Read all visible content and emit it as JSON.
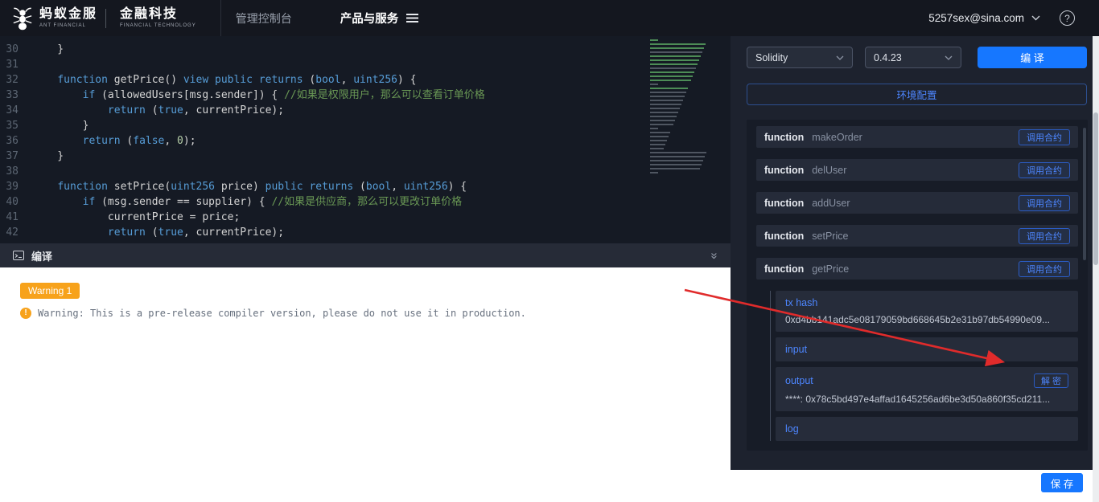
{
  "header": {
    "brand": {
      "name_cn": "蚂蚁金服",
      "name_en": "ANT FINANCIAL",
      "division_cn": "金融科技",
      "division_en": "FINANCIAL TECHNOLOGY"
    },
    "nav_console": "管理控制台",
    "nav_products": "产品与服务",
    "account": "5257sex@sina.com",
    "help_label": "?"
  },
  "editor": {
    "lines": [
      {
        "no": "30",
        "tokens": [
          {
            "t": "    }",
            "c": "p"
          }
        ]
      },
      {
        "no": "31",
        "tokens": [
          {
            "t": "",
            "c": "p"
          }
        ]
      },
      {
        "no": "32",
        "tokens": [
          {
            "t": "    ",
            "c": "p"
          },
          {
            "t": "function",
            "c": "k"
          },
          {
            "t": " getPrice() ",
            "c": "p"
          },
          {
            "t": "view",
            "c": "k"
          },
          {
            "t": " ",
            "c": "p"
          },
          {
            "t": "public",
            "c": "k"
          },
          {
            "t": " ",
            "c": "p"
          },
          {
            "t": "returns",
            "c": "k"
          },
          {
            "t": " (",
            "c": "p"
          },
          {
            "t": "bool",
            "c": "k"
          },
          {
            "t": ", ",
            "c": "p"
          },
          {
            "t": "uint256",
            "c": "k"
          },
          {
            "t": ") {",
            "c": "p"
          }
        ]
      },
      {
        "no": "33",
        "tokens": [
          {
            "t": "        ",
            "c": "p"
          },
          {
            "t": "if",
            "c": "k"
          },
          {
            "t": " (allowedUsers[msg.sender]) { ",
            "c": "p"
          },
          {
            "t": "//如果是权限用户，那么可以查看订单价格",
            "c": "c"
          }
        ]
      },
      {
        "no": "34",
        "tokens": [
          {
            "t": "            ",
            "c": "p"
          },
          {
            "t": "return",
            "c": "k"
          },
          {
            "t": " (",
            "c": "p"
          },
          {
            "t": "true",
            "c": "k"
          },
          {
            "t": ", currentPrice);",
            "c": "p"
          }
        ]
      },
      {
        "no": "35",
        "tokens": [
          {
            "t": "        }",
            "c": "p"
          }
        ]
      },
      {
        "no": "36",
        "tokens": [
          {
            "t": "        ",
            "c": "p"
          },
          {
            "t": "return",
            "c": "k"
          },
          {
            "t": " (",
            "c": "p"
          },
          {
            "t": "false",
            "c": "k"
          },
          {
            "t": ", ",
            "c": "p"
          },
          {
            "t": "0",
            "c": "n"
          },
          {
            "t": ");",
            "c": "p"
          }
        ]
      },
      {
        "no": "37",
        "tokens": [
          {
            "t": "    }",
            "c": "p"
          }
        ]
      },
      {
        "no": "38",
        "tokens": [
          {
            "t": "",
            "c": "p"
          }
        ]
      },
      {
        "no": "39",
        "tokens": [
          {
            "t": "    ",
            "c": "p"
          },
          {
            "t": "function",
            "c": "k"
          },
          {
            "t": " setPrice(",
            "c": "p"
          },
          {
            "t": "uint256",
            "c": "k"
          },
          {
            "t": " price) ",
            "c": "p"
          },
          {
            "t": "public",
            "c": "k"
          },
          {
            "t": " ",
            "c": "p"
          },
          {
            "t": "returns",
            "c": "k"
          },
          {
            "t": " (",
            "c": "p"
          },
          {
            "t": "bool",
            "c": "k"
          },
          {
            "t": ", ",
            "c": "p"
          },
          {
            "t": "uint256",
            "c": "k"
          },
          {
            "t": ") {",
            "c": "p"
          }
        ]
      },
      {
        "no": "40",
        "tokens": [
          {
            "t": "        ",
            "c": "p"
          },
          {
            "t": "if",
            "c": "k"
          },
          {
            "t": " (msg.sender == supplier) { ",
            "c": "p"
          },
          {
            "t": "//如果是供应商，那么可以更改订单价格",
            "c": "c"
          }
        ]
      },
      {
        "no": "41",
        "tokens": [
          {
            "t": "            currentPrice = price;",
            "c": "p"
          }
        ]
      },
      {
        "no": "42",
        "tokens": [
          {
            "t": "            ",
            "c": "p"
          },
          {
            "t": "return",
            "c": "k"
          },
          {
            "t": " (",
            "c": "p"
          },
          {
            "t": "true",
            "c": "k"
          },
          {
            "t": ", currentPrice);",
            "c": "p"
          }
        ]
      }
    ]
  },
  "compile_panel": {
    "title": "编译",
    "collapse_icon": "»",
    "warning_badge": "Warning 1",
    "warning_icon": "!",
    "warning_text": "Warning: This is a pre-release compiler version, please do not use it in production."
  },
  "right_panel": {
    "language_select": "Solidity",
    "version_select": "0.4.23",
    "compile_button": "编 译",
    "env_button": "环境配置",
    "functions": [
      {
        "keyword": "function",
        "name": "makeOrder",
        "action": "调用合约"
      },
      {
        "keyword": "function",
        "name": "delUser",
        "action": "调用合约"
      },
      {
        "keyword": "function",
        "name": "addUser",
        "action": "调用合约"
      },
      {
        "keyword": "function",
        "name": "setPrice",
        "action": "调用合约"
      }
    ],
    "expanded": {
      "keyword": "function",
      "name": "getPrice",
      "action": "调用合约",
      "tx_hash_label": "tx hash",
      "tx_hash_value": "0xd4bb141adc5e08179059bd668645b2e31b97db54990e09...",
      "input_label": "input",
      "output_label": "output",
      "decrypt_button": "解 密",
      "output_value": "****: 0x78c5bd497e4affad1645256ad6be3d50a860f35cd211...",
      "log_label": "log"
    },
    "save_button": "保 存"
  },
  "colors": {
    "accent_blue": "#1677ff",
    "link_blue": "#4d86ff",
    "warning_orange": "#f7a21b",
    "annotation_arrow_red": "#e02b2b",
    "code_keyword": "#569cd6",
    "code_comment": "#6a9955"
  }
}
